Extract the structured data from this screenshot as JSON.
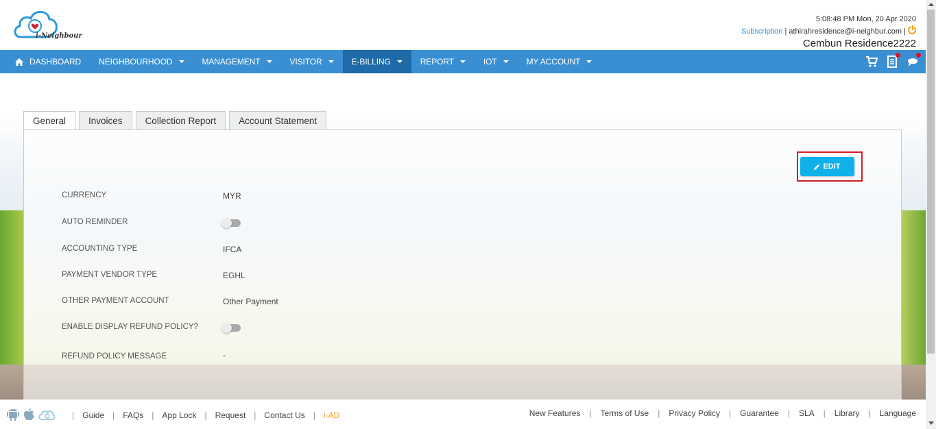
{
  "header": {
    "brand": "i-Neighbour",
    "datetime": "5:08:48 PM  Mon, 20 Apr 2020",
    "subscription_link": "Subscription",
    "user_email": "athirahresidence@i-neighbur.com",
    "residence": "Cembun Residence2222"
  },
  "nav": {
    "items": [
      {
        "label": "DASHBOARD"
      },
      {
        "label": "NEIGHBOURHOOD"
      },
      {
        "label": "MANAGEMENT"
      },
      {
        "label": "VISITOR"
      },
      {
        "label": "E-BILLING"
      },
      {
        "label": "REPORT"
      },
      {
        "label": "IOT"
      },
      {
        "label": "MY ACCOUNT"
      }
    ],
    "active": "E-BILLING"
  },
  "tabs": [
    {
      "label": "General"
    },
    {
      "label": "Invoices"
    },
    {
      "label": "Collection Report"
    },
    {
      "label": "Account Statement"
    }
  ],
  "edit_label": "EDIT",
  "settings": {
    "currency": {
      "label": "CURRENCY",
      "value": "MYR"
    },
    "auto_reminder": {
      "label": "AUTO REMINDER",
      "enabled": false
    },
    "accounting_type": {
      "label": "ACCOUNTING TYPE",
      "value": "IFCA"
    },
    "payment_vendor_type": {
      "label": "PAYMENT VENDOR TYPE",
      "value": "EGHL"
    },
    "other_payment_account": {
      "label": "OTHER PAYMENT ACCOUNT",
      "value": "Other Payment"
    },
    "enable_refund_policy": {
      "label": "ENABLE DISPLAY REFUND POLICY?",
      "enabled": false
    },
    "refund_policy_message": {
      "label": "REFUND POLICY MESSAGE",
      "value": "-"
    }
  },
  "footer": {
    "links_left": [
      "Guide",
      "FAQs",
      "App Lock",
      "Request",
      "Contact Us"
    ],
    "iad": "i-AD",
    "links_right": [
      "New Features",
      "Terms of Use",
      "Privacy Policy",
      "Guarantee",
      "SLA",
      "Library",
      "Language"
    ]
  },
  "colors": {
    "nav_bg": "#3a8fd3",
    "nav_active": "#1f6aa8",
    "edit_button": "#10b0ea",
    "highlight_frame": "#d61c22",
    "link": "#2a8dd4",
    "accent_orange": "#f0a030"
  }
}
